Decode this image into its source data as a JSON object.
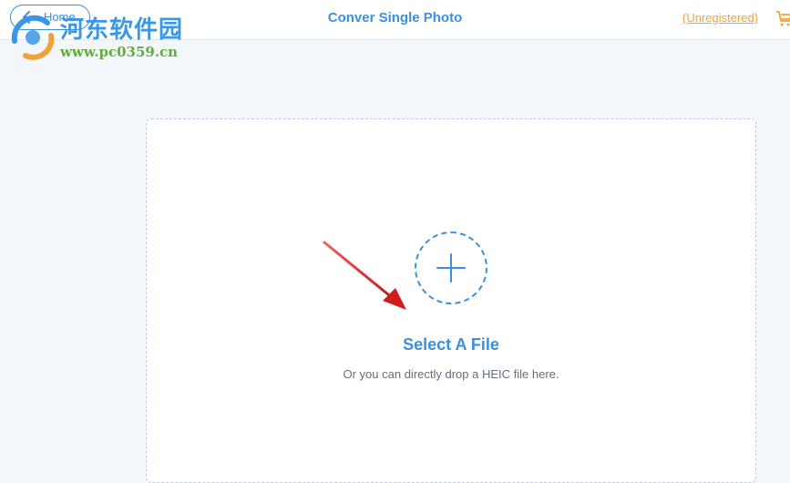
{
  "header": {
    "home_label": "Home",
    "title": "Conver Single Photo",
    "unregistered_label": "(Unregistered)",
    "cart_icon": "cart-icon"
  },
  "watermark": {
    "site_name": "河东软件园",
    "site_url": "www.pc0359.cn"
  },
  "dropzone": {
    "add_icon": "plus-icon",
    "select_label": "Select A File",
    "hint": "Or you can directly drop a HEIC file here."
  },
  "colors": {
    "accent": "#3b8fe0",
    "warning": "#f0a23a",
    "annotation_arrow": "#e02020",
    "background": "#f3f6fb"
  }
}
